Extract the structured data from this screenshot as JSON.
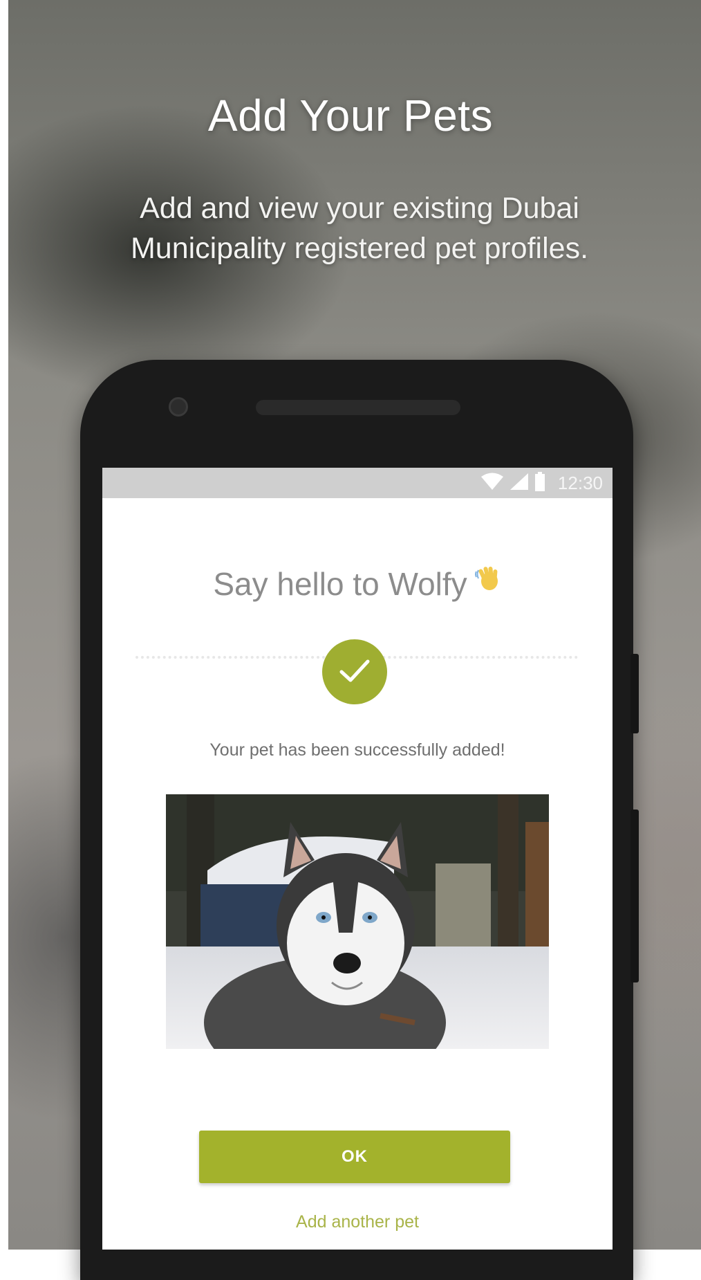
{
  "promo": {
    "title": "Add Your Pets",
    "subtitle": "Add and view your existing Dubai Municipality registered pet profiles."
  },
  "phone": {
    "status_bar": {
      "time": "12:30",
      "icons": [
        "wifi-icon",
        "cellular-signal-icon",
        "battery-icon"
      ]
    },
    "screen": {
      "greeting": "Say hello to Wolfy",
      "greeting_icon": "waving-hand-icon",
      "success_icon": "check-circle-icon",
      "success_message": "Your pet has been successfully added!",
      "photo_subject": "husky-dog-photo",
      "ok_button": "OK",
      "add_another_link": "Add another pet"
    }
  },
  "colors": {
    "accent": "#a3b22c",
    "check": "#9fae31",
    "link": "#a9b449",
    "status_bar": "#cfcfcf"
  }
}
